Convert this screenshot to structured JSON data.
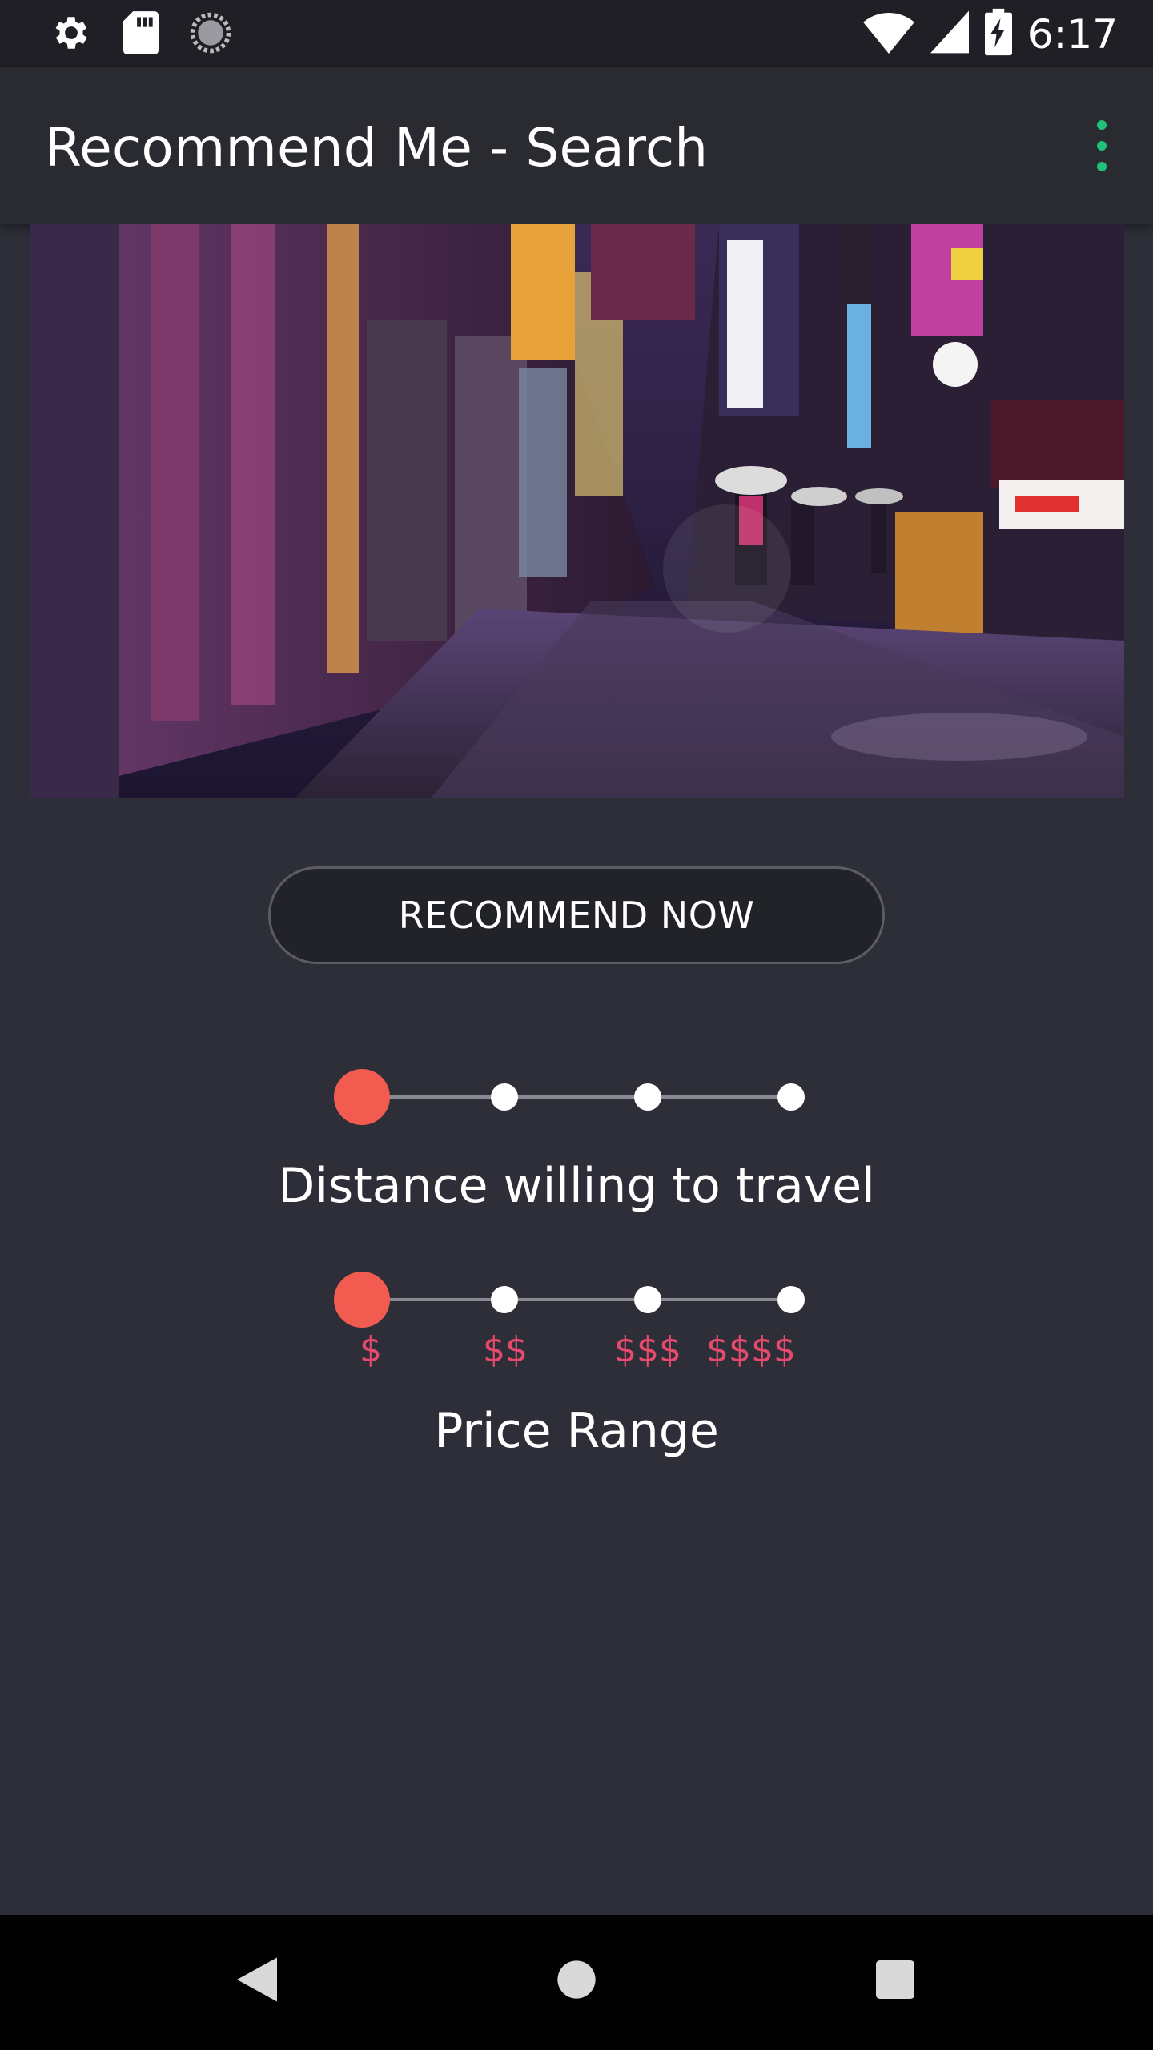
{
  "status_bar": {
    "time": "6:17",
    "icons": [
      "settings-icon",
      "sd-card-icon",
      "sync-icon",
      "wifi-icon",
      "signal-icon",
      "battery-charging-icon"
    ]
  },
  "app_bar": {
    "title": "Recommend Me - Search",
    "menu_icon": "overflow-menu-icon",
    "accent_color": "#20c27a"
  },
  "hero": {
    "icon": "street-photo"
  },
  "main": {
    "recommend_button_label": "RECOMMEND NOW",
    "distance_label": "Distance willing to travel",
    "distance_selected_index": 0,
    "price_label": "Price Range",
    "price_selected_index": 0,
    "price_ticks": [
      "$",
      "$$",
      "$$$",
      "$$$$"
    ],
    "active_color": "#f25c50",
    "tick_color": "#e84a6e"
  },
  "nav_bar": {
    "icons": [
      "back-icon",
      "home-icon",
      "recents-icon"
    ]
  }
}
